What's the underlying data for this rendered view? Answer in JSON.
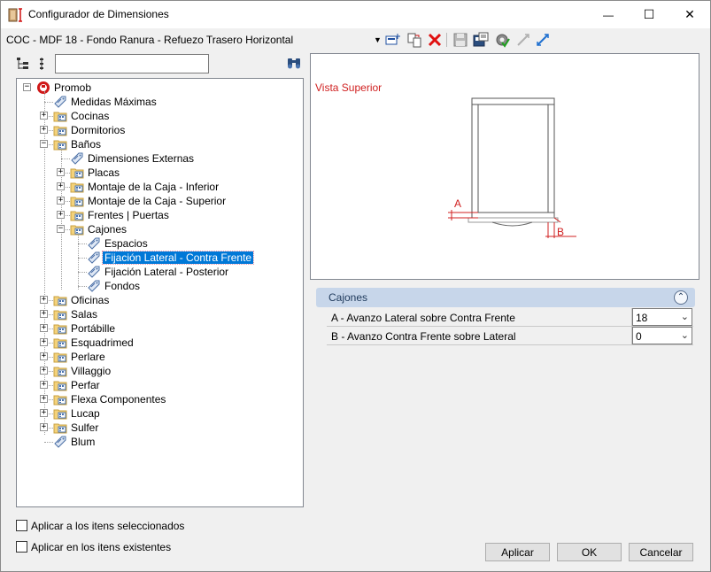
{
  "window": {
    "title": "Configurador de Dimensiones",
    "controls": {
      "minimize": "—",
      "maximize": "☐",
      "close": "✕"
    }
  },
  "toolbar": {
    "config_title": "COC - MDF 18 - Fondo Ranura - Refuezo Trasero Horizontal",
    "dropdown_arrow": "▼",
    "icons": [
      "add-icon",
      "copy-icon",
      "delete-icon",
      "save-icon",
      "export-icon",
      "settings-icon",
      "collapse-icon",
      "expand-icon"
    ]
  },
  "search": {
    "value": "",
    "placeholder": ""
  },
  "tree": {
    "root": "Promob",
    "items": [
      {
        "label": "Medidas Máximas",
        "type": "tag"
      },
      {
        "label": "Cocinas",
        "type": "folder"
      },
      {
        "label": "Dormitorios",
        "type": "folder"
      },
      {
        "label": "Baños",
        "type": "folder-open"
      },
      {
        "label": "Dimensiones Externas",
        "type": "tag"
      },
      {
        "label": "Placas",
        "type": "folder"
      },
      {
        "label": "Montaje de la Caja - Inferior",
        "type": "folder"
      },
      {
        "label": "Montaje de la Caja - Superior",
        "type": "folder"
      },
      {
        "label": "Frentes | Puertas",
        "type": "folder"
      },
      {
        "label": "Cajones",
        "type": "folder-open"
      },
      {
        "label": "Espacios",
        "type": "tag"
      },
      {
        "label": "Fijación Lateral - Contra Frente",
        "type": "tag",
        "selected": true
      },
      {
        "label": "Fijación Lateral - Posterior",
        "type": "tag"
      },
      {
        "label": "Fondos",
        "type": "tag"
      },
      {
        "label": "Oficinas",
        "type": "folder"
      },
      {
        "label": "Salas",
        "type": "folder"
      },
      {
        "label": "Portábille",
        "type": "folder"
      },
      {
        "label": "Esquadrimed",
        "type": "folder"
      },
      {
        "label": "Perlare",
        "type": "folder"
      },
      {
        "label": "Villaggio",
        "type": "folder"
      },
      {
        "label": "Perfar",
        "type": "folder"
      },
      {
        "label": "Flexa Componentes",
        "type": "folder"
      },
      {
        "label": "Lucap",
        "type": "folder"
      },
      {
        "label": "Sulfer",
        "type": "folder"
      },
      {
        "label": "Blum",
        "type": "tag"
      }
    ]
  },
  "options": {
    "apply_selected": "Aplicar a los itens seleccionados",
    "apply_existing": "Aplicar en los itens existentes"
  },
  "preview": {
    "title": "Vista Superior",
    "label_a": "A",
    "label_b": "B"
  },
  "property_grid": {
    "category": "Cajones",
    "rows": [
      {
        "name": "A - Avanzo Lateral sobre Contra Frente",
        "value": "18"
      },
      {
        "name": "B - Avanzo Contra Frente sobre Lateral",
        "value": "0"
      }
    ]
  },
  "buttons": {
    "apply": "Aplicar",
    "ok": "OK",
    "cancel": "Cancelar"
  },
  "colors": {
    "selection": "#0078d7",
    "preview_text": "#d02020",
    "category_header": "#c7d6ea"
  }
}
